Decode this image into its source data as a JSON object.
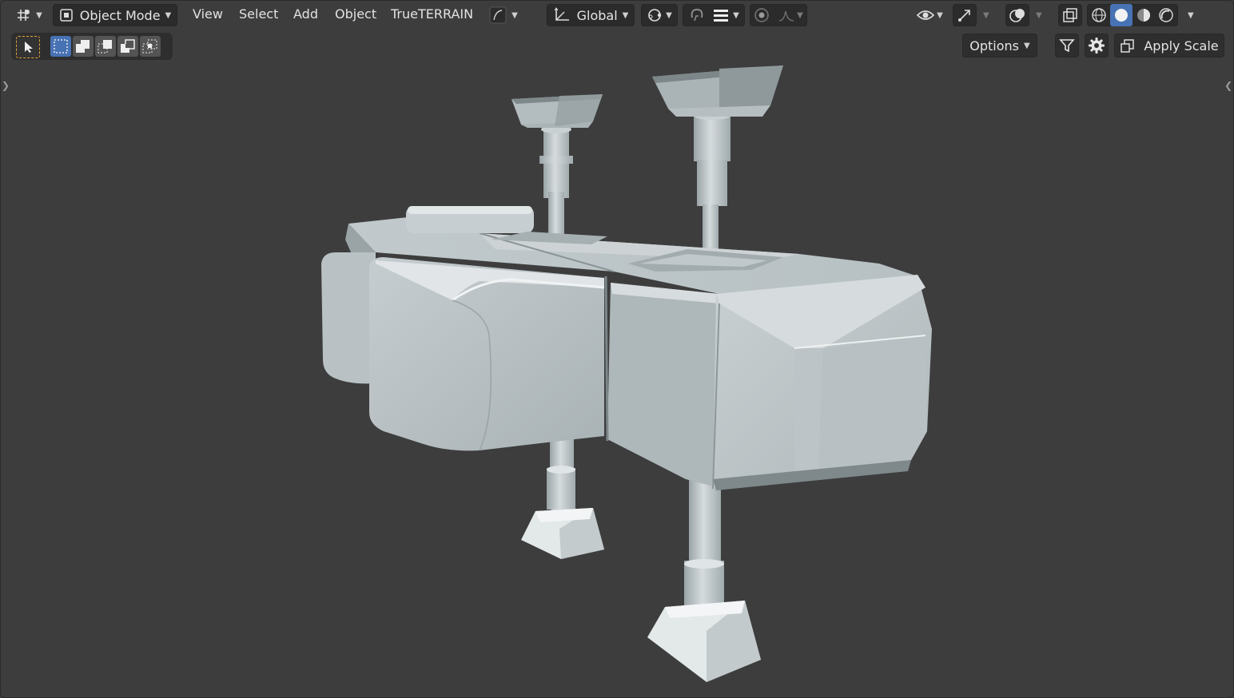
{
  "header": {
    "editor_type_icon": "3d-viewport-icon",
    "mode": {
      "icon": "object-mode-icon",
      "label": "Object Mode"
    },
    "menus": [
      "View",
      "Select",
      "Add",
      "Object",
      "TrueTERRAIN"
    ],
    "transform_orientation": {
      "icon": "orientation-axes-icon",
      "label": "Global"
    },
    "icons": [
      "pivot-point-icon",
      "snap-icon",
      "snap-increment-icon",
      "proportional-edit-icon",
      "falloff-icon",
      "visibility-icon",
      "gizmo-icon",
      "overlay-icon",
      "xray-icon",
      "shading-wireframe-icon",
      "shading-solid-icon",
      "shading-material-icon",
      "shading-rendered-icon"
    ]
  },
  "tool_settings": {
    "active_tool_icon": "select-box-tool-icon",
    "selection_modes": [
      "set-new-selection-icon",
      "extend-selection-icon",
      "subtract-selection-icon",
      "invert-selection-icon",
      "intersect-selection-icon"
    ],
    "options_label": "Options",
    "apply_scale_label": "Apply Scale"
  },
  "colors": {
    "viewport_bg": "#3d3d3d",
    "header_button_bg": "#2b2b2b",
    "active_blue": "#4772b3",
    "tool_orange": "#e7a33a",
    "model_light": "#d8dee0",
    "model_mid": "#b3bcbf",
    "model_dark": "#8d979a"
  }
}
